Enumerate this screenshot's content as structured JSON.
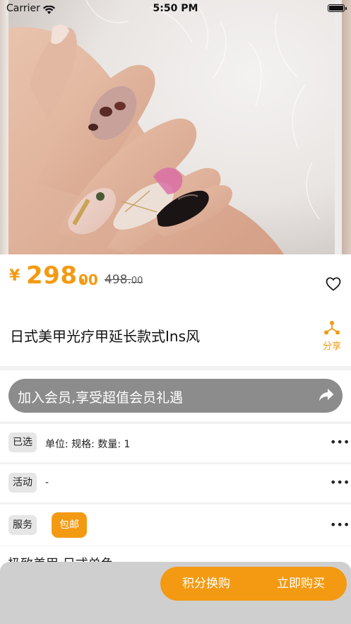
{
  "status_bar": {
    "carrier": "Carrier",
    "time": "5:50 PM"
  },
  "gallery": {
    "image": "nail-art-photo",
    "description_icon": "photo"
  },
  "price": {
    "currency_symbol": "¥",
    "integer": "298.",
    "decimal": "00",
    "original_integer": "498.",
    "original_decimal": "00"
  },
  "product": {
    "title": "日式美甲光疗甲延长款式Ins风",
    "share_label": "分享"
  },
  "member": {
    "banner_text": "加入会员,享受超值会员礼遇"
  },
  "options": {
    "selected_tag": "已选",
    "selected_text": "单位:  规格:  数量: 1",
    "activity_tag": "活动",
    "activity_text": "-",
    "service_tag": "服务",
    "service_badge": "包邮",
    "more": "•••"
  },
  "peek": {
    "text": "极致美甲   日式单色"
  },
  "actions": {
    "points_exchange": "积分换购",
    "buy_now": "立即购买"
  },
  "colors": {
    "accent": "#f39a12",
    "member_bar": "#8c8c8c",
    "bottom_bar": "#cfcfcf"
  }
}
